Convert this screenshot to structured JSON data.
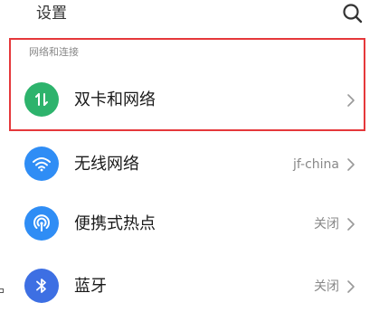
{
  "header": {
    "title": "设置",
    "search_icon": "search-icon"
  },
  "section": {
    "title": "网络和连接"
  },
  "colors": {
    "highlight_border": "#e5383b",
    "dual_sim_icon_bg": "#2db36c",
    "wlan_icon_bg": "#2f8df5",
    "hotspot_icon_bg": "#2f8df5",
    "bluetooth_icon_bg": "#3d6fe3"
  },
  "rows": [
    {
      "label": "双卡和网络",
      "value": "",
      "icon": "dual-sim-icon"
    },
    {
      "label": "无线网络",
      "value": "jf-china",
      "icon": "wifi-icon"
    },
    {
      "label": "便携式热点",
      "value": "关闭",
      "icon": "hotspot-icon"
    },
    {
      "label": "蓝牙",
      "value": "关闭",
      "icon": "bluetooth-icon"
    }
  ]
}
